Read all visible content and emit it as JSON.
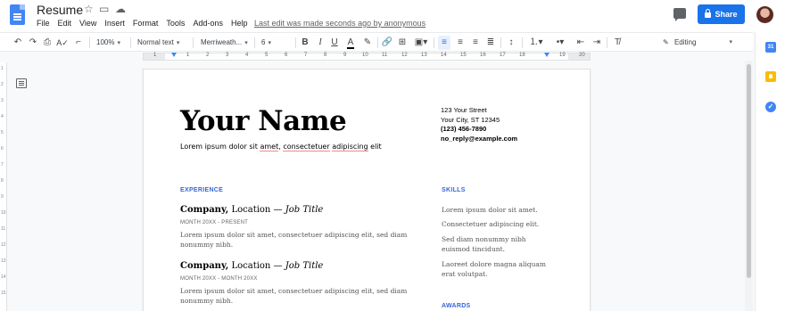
{
  "titlebar": {
    "doc_title": "Resume",
    "menu": [
      "File",
      "Edit",
      "View",
      "Insert",
      "Format",
      "Tools",
      "Add-ons",
      "Help"
    ],
    "last_edit": "Last edit was made seconds ago by anonymous",
    "share_label": "Share"
  },
  "toolbar": {
    "zoom": "100%",
    "style": "Normal text",
    "font": "Merriweath...",
    "font_size": "6",
    "bold": "B",
    "italic": "I",
    "underline": "U",
    "text_color": "A",
    "mode": "Editing"
  },
  "ruler": {
    "numbers": [
      "1",
      "1",
      "2",
      "3",
      "4",
      "5",
      "6",
      "7",
      "8",
      "9",
      "10",
      "11",
      "12",
      "13",
      "14",
      "15",
      "16",
      "17",
      "18",
      "19",
      "20"
    ]
  },
  "vruler": {
    "numbers": [
      "1",
      "2",
      "3",
      "4",
      "5",
      "6",
      "7",
      "8",
      "9",
      "10",
      "11",
      "12",
      "13",
      "14",
      "15"
    ]
  },
  "document": {
    "name": "Your Name",
    "tagline_parts": [
      "Lorem ipsum dolor sit ",
      "amet",
      ", ",
      "consectetuer",
      " ",
      "adipiscing",
      " elit"
    ],
    "contact": {
      "street": "123 Your Street",
      "city": "Your City, ST 12345",
      "phone": "(123) 456-7890",
      "email": "no_reply@example.com"
    },
    "experience_heading": "EXPERIENCE",
    "jobs": [
      {
        "company": "Company,",
        "location": " Location — ",
        "title": "Job Title",
        "dates": "MONTH 20XX - PRESENT",
        "desc": "Lorem ipsum dolor sit amet, consectetuer adipiscing elit, sed diam nonummy nibh."
      },
      {
        "company": "Company,",
        "location": " Location — ",
        "title": "Job Title",
        "dates": "MONTH 20XX - MONTH 20XX",
        "desc": "Lorem ipsum dolor sit amet, consectetuer adipiscing elit, sed diam nonummy nibh."
      }
    ],
    "skills_heading": "SKILLS",
    "skills": [
      "Lorem ipsum dolor sit amet.",
      "Consectetuer adipiscing elit.",
      "Sed diam nonummy nibh euismod tincidunt.",
      "Laoreet dolore magna aliquam erat volutpat."
    ],
    "awards_heading": "AWARDS"
  },
  "sidepanel": {
    "calendar_day": "31",
    "tasks_glyph": "✓"
  },
  "colors": {
    "accent": "#1a73e8",
    "section_heading": "#3367d6",
    "doc_icon": "#4285f4",
    "keep": "#fbbc04"
  }
}
